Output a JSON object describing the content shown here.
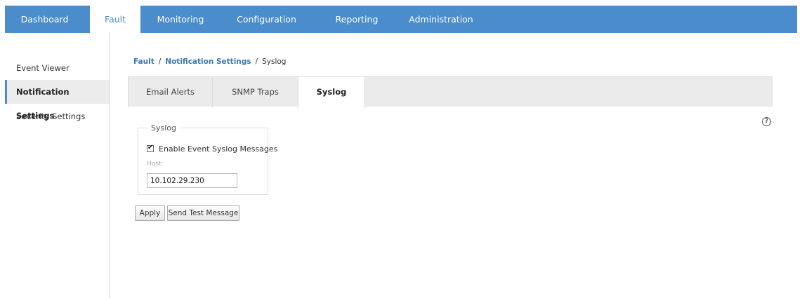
{
  "topnav": {
    "items": [
      "Dashboard",
      "Fault",
      "Monitoring",
      "Configuration",
      "Reporting",
      "Administration"
    ],
    "active": "Fault"
  },
  "sidebar": {
    "items": [
      "Event Viewer",
      "Notification Settings",
      "Severity Settings"
    ],
    "active": "Notification Settings"
  },
  "breadcrumb": {
    "items": [
      "Fault",
      "Notification Settings",
      "Syslog"
    ],
    "separator": "/"
  },
  "tabs": {
    "items": [
      "Email Alerts",
      "SNMP Traps",
      "Syslog"
    ],
    "active": "Syslog"
  },
  "help_icon": "?",
  "syslog_form": {
    "legend": "Syslog",
    "enable_label": "Enable Event Syslog Messages",
    "enable_checked": true,
    "checkmark": "✔",
    "host_label": "Host:",
    "host_value": "10.102.29.230"
  },
  "buttons": {
    "apply": "Apply",
    "send_test": "Send Test Message"
  },
  "colors": {
    "accent": "#4a8ccc",
    "link": "#3b78b5"
  }
}
